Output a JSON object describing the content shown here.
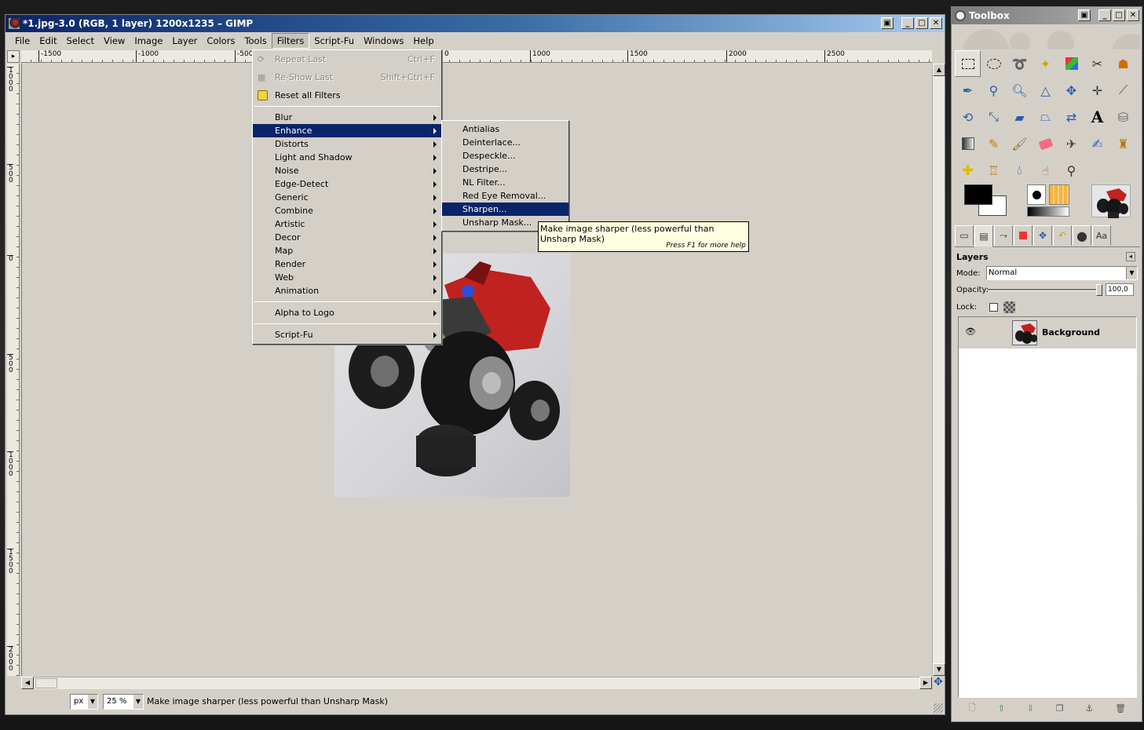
{
  "window": {
    "title": "*1.jpg-3.0 (RGB, 1 layer) 1200x1235 – GIMP"
  },
  "menubar": [
    "File",
    "Edit",
    "Select",
    "View",
    "Image",
    "Layer",
    "Colors",
    "Tools",
    "Filters",
    "Script-Fu",
    "Windows",
    "Help"
  ],
  "ruler_h": [
    "-1500",
    "-1000",
    "-500",
    "0",
    "1000",
    "1500",
    "2000",
    "2500"
  ],
  "ruler_v": [
    "1000",
    "500",
    "0",
    "500",
    "1000",
    "1500",
    "2000"
  ],
  "filters_menu": {
    "repeat_last": "Repeat Last",
    "repeat_last_acc": "Ctrl+F",
    "reshow_last": "Re-Show Last",
    "reshow_last_acc": "Shift+Ctrl+F",
    "reset_all": "Reset all Filters",
    "categories": [
      "Blur",
      "Enhance",
      "Distorts",
      "Light and Shadow",
      "Noise",
      "Edge-Detect",
      "Generic",
      "Combine",
      "Artistic",
      "Decor",
      "Map",
      "Render",
      "Web",
      "Animation"
    ],
    "alpha_to_logo": "Alpha to Logo",
    "script_fu": "Script-Fu"
  },
  "enhance_menu": [
    "Antialias",
    "Deinterlace...",
    "Despeckle...",
    "Destripe...",
    "NL Filter...",
    "Red Eye Removal...",
    "Sharpen...",
    "Unsharp Mask..."
  ],
  "tooltip": {
    "text": "Make image sharper (less powerful than Unsharp Mask)",
    "help": "Press F1 for more help"
  },
  "statusbar": {
    "unit": "px",
    "zoom": "25 %",
    "message": "Make image sharper (less powerful than Unsharp Mask)"
  },
  "toolbox": {
    "title": "Toolbox"
  },
  "layers": {
    "title": "Layers",
    "mode_label": "Mode:",
    "mode_value": "Normal",
    "opacity_label": "Opacity:",
    "opacity_value": "100,0",
    "lock_label": "Lock:",
    "layer_name": "Background"
  },
  "colors": {
    "menu_highlight": "#0a246a",
    "tooltip_bg": "#ffffe1",
    "chrome": "#d4d0c8"
  }
}
